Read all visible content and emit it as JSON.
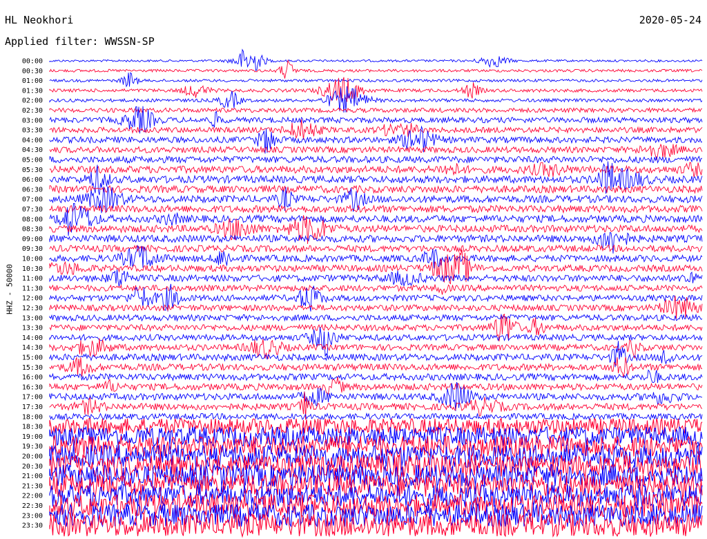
{
  "header": {
    "station": "HL Neokhori",
    "date": "2020-05-24",
    "filter_label": "Applied filter: WWSSN-SP"
  },
  "axis": {
    "ylabel": "HHZ - 50000"
  },
  "colors": {
    "even": "#0000ff",
    "odd": "#ff0033",
    "background": "#ffffff",
    "text": "#000000"
  },
  "chart_data": {
    "type": "line",
    "title": "HL Neokhori",
    "subtitle": "Applied filter: WWSSN-SP",
    "ylabel": "HHZ - 50000",
    "row_labels": [
      "00:00",
      "00:30",
      "01:00",
      "01:30",
      "02:00",
      "02:30",
      "03:00",
      "03:30",
      "04:00",
      "04:30",
      "05:00",
      "05:30",
      "06:00",
      "06:30",
      "07:00",
      "07:30",
      "08:00",
      "08:30",
      "09:00",
      "09:30",
      "10:00",
      "10:30",
      "11:00",
      "11:30",
      "12:00",
      "12:30",
      "13:00",
      "13:30",
      "14:00",
      "14:30",
      "15:00",
      "15:30",
      "16:00",
      "16:30",
      "17:00",
      "17:30",
      "18:00",
      "18:30",
      "19:00",
      "19:30",
      "20:00",
      "20:30",
      "21:00",
      "21:30",
      "22:00",
      "22:30",
      "23:00",
      "23:30"
    ],
    "row_noise_level": [
      0.05,
      0.1,
      0.1,
      0.15,
      0.15,
      0.25,
      0.35,
      0.35,
      0.4,
      0.4,
      0.45,
      0.5,
      0.5,
      0.5,
      0.5,
      0.5,
      0.5,
      0.5,
      0.5,
      0.45,
      0.45,
      0.45,
      0.45,
      0.4,
      0.4,
      0.4,
      0.4,
      0.4,
      0.4,
      0.4,
      0.45,
      0.45,
      0.45,
      0.45,
      0.45,
      0.45,
      0.4,
      1.3,
      1.6,
      1.8,
      1.9,
      1.9,
      1.9,
      1.9,
      1.9,
      1.9,
      1.9,
      1.9
    ],
    "series_colors": [
      "blue",
      "red"
    ],
    "grid": false
  }
}
